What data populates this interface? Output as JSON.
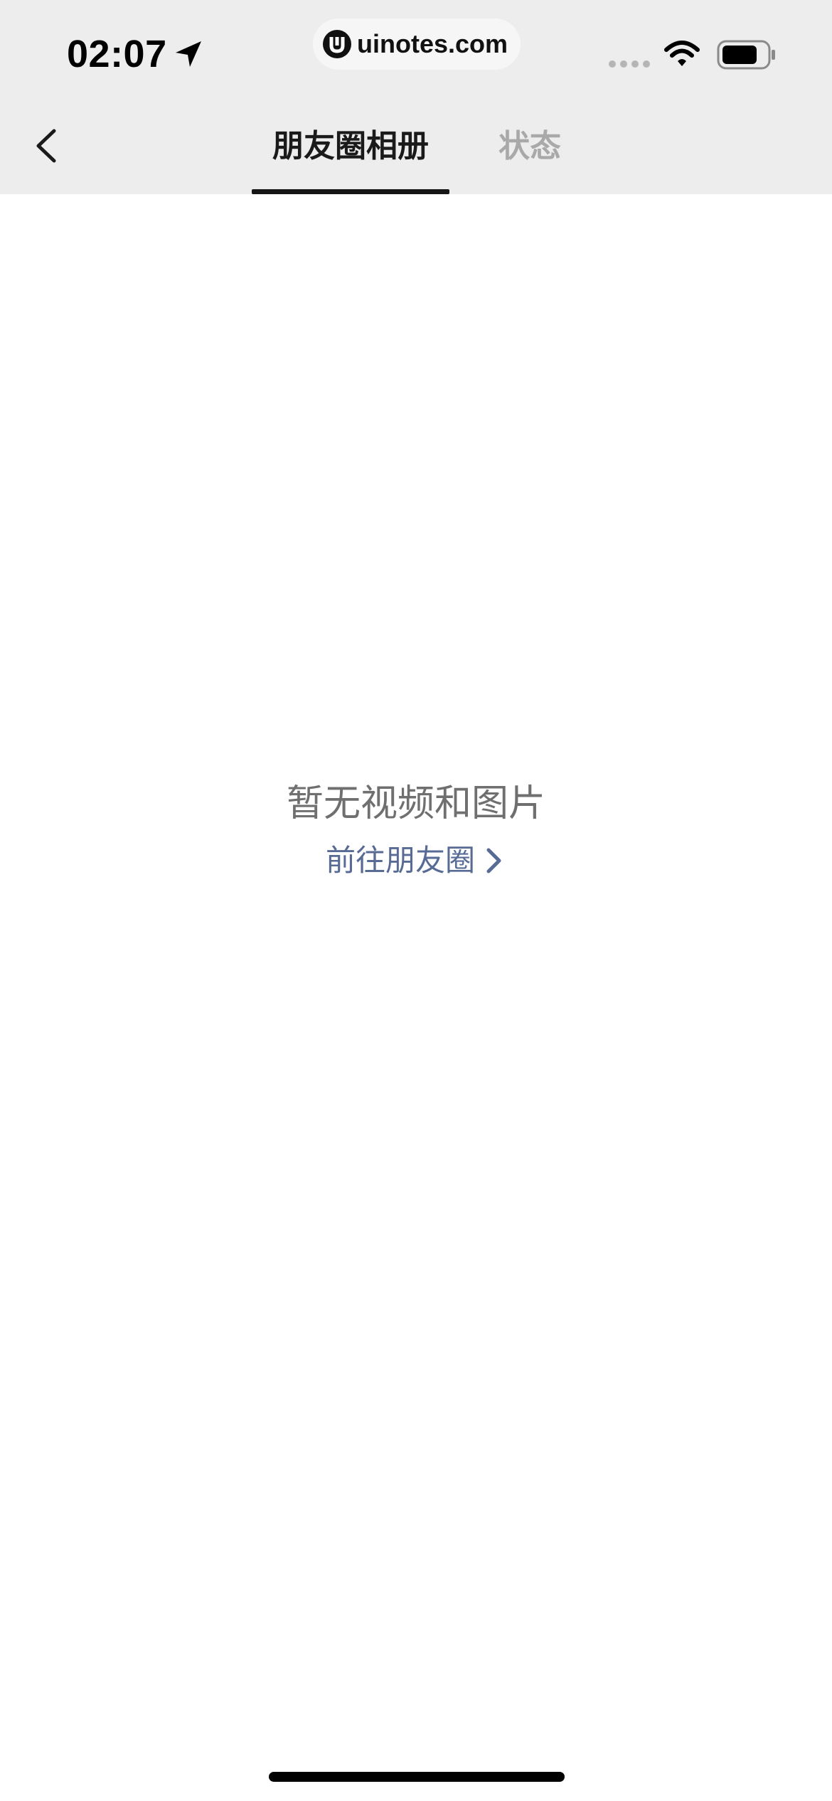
{
  "status_bar": {
    "time": "02:07",
    "url": "uinotes.com",
    "icons": [
      "location-arrow-icon",
      "signal-icon",
      "wifi-icon",
      "battery-icon"
    ]
  },
  "nav": {
    "back_icon": "chevron-left-icon",
    "tabs": [
      {
        "label": "朋友圈相册",
        "active": true
      },
      {
        "label": "状态",
        "active": false
      }
    ]
  },
  "empty_state": {
    "message": "暂无视频和图片",
    "link_label": "前往朋友圈",
    "link_icon": "chevron-right-icon"
  },
  "colors": {
    "header_bg": "#ededed",
    "page_bg": "#ffffff",
    "active_tab": "#1a1a1a",
    "inactive_tab": "#a9a9a9",
    "message": "#6f6f6f",
    "link": "#576b95"
  }
}
